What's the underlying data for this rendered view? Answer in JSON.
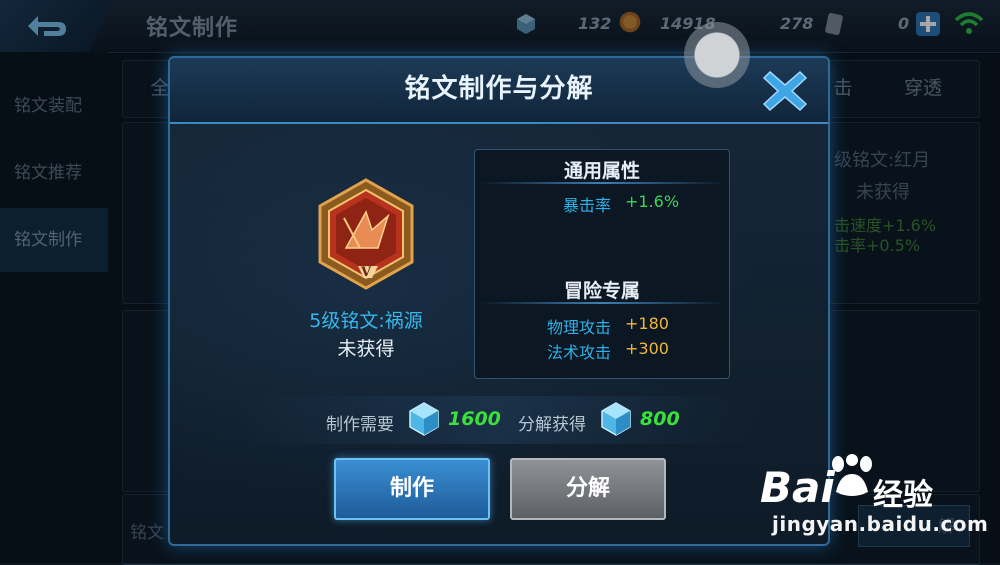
{
  "topbar": {
    "title": "铭文制作",
    "resources": [
      {
        "icon": "crystal-icon",
        "value": "132"
      },
      {
        "icon": "gold-coin-icon",
        "value": "14918"
      },
      {
        "icon": "scroll-ticket-icon",
        "value": "278"
      },
      {
        "icon": "diamond-add-icon",
        "value": "0"
      }
    ]
  },
  "sidebar": {
    "items": [
      {
        "label": "铭文装配"
      },
      {
        "label": "铭文推荐"
      },
      {
        "label": "铭文制作"
      }
    ]
  },
  "background": {
    "tab_left": "全",
    "tabs_right": [
      "击",
      "穿透"
    ],
    "side_rune_name": "级铭文:红月",
    "side_rune_status": "未获得",
    "side_stat_1": "击速度+1.6%",
    "side_stat_2": "击率+0.5%",
    "bottom_left": "铭文",
    "bottom_right_btn": "解"
  },
  "modal": {
    "title": "铭文制作与分解",
    "rune": {
      "name": "5级铭文:祸源",
      "status": "未获得",
      "level_mark": "V"
    },
    "general_section": {
      "title": "通用属性",
      "stats": [
        {
          "key": "暴击率",
          "value": "+1.6%"
        }
      ]
    },
    "adventure_section": {
      "title": "冒险专属",
      "stats": [
        {
          "key": "物理攻击",
          "value": "+180"
        },
        {
          "key": "法术攻击",
          "value": "+300"
        }
      ]
    },
    "craft_cost_label": "制作需要",
    "craft_cost_value": "1600",
    "decompose_gain_label": "分解获得",
    "decompose_gain_value": "800",
    "craft_button": "制作",
    "decompose_button": "分解"
  },
  "watermark": {
    "brand": "Bai",
    "brand_cn": "经验",
    "url": "jingyan.baidu.com"
  },
  "colors": {
    "accent_blue": "#38b7ea",
    "stat_green": "#3ed456",
    "stat_yellow": "#f1b63a",
    "cost_green": "#3ce03a"
  }
}
